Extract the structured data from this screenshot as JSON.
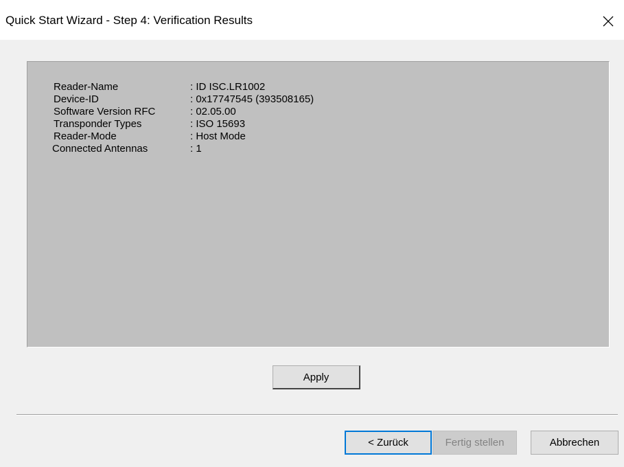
{
  "window": {
    "title": "Quick Start Wizard - Step 4: Verification Results"
  },
  "info": {
    "rows": [
      {
        "label": "Reader-Name",
        "value": ": ID ISC.LR1002"
      },
      {
        "label": "Device-ID",
        "value": ": 0x17747545 (393508165)"
      },
      {
        "label": "Software Version RFC",
        "value": ": 02.05.00"
      },
      {
        "label": "Transponder Types",
        "value": ": ISO 15693"
      },
      {
        "label": "Reader-Mode",
        "value": ": Host Mode"
      },
      {
        "label": "Connected Antennas",
        "value": ": 1"
      }
    ]
  },
  "buttons": {
    "apply": "Apply",
    "back": "< Zurück",
    "finish": "Fertig stellen",
    "cancel": "Abbrechen"
  },
  "colors": {
    "panel_bg": "#c0c0c0",
    "dialog_bg": "#f0f0f0",
    "focus_border": "#0078d7",
    "disabled_text": "#838383"
  },
  "icons": {
    "close": "close-icon"
  }
}
